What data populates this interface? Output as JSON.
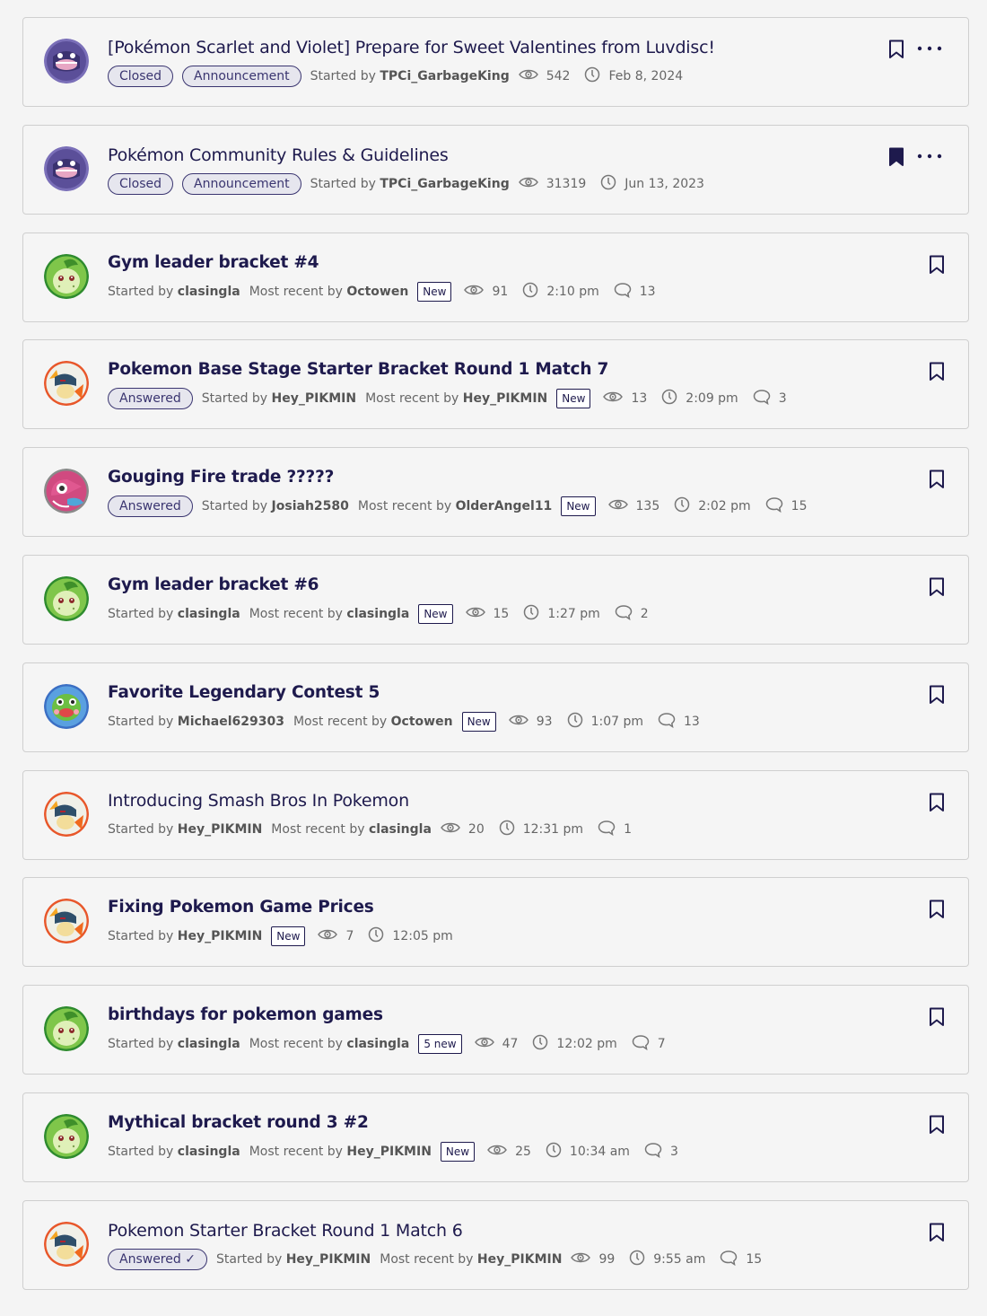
{
  "labels": {
    "started_by": "Started by",
    "most_recent_by": "Most recent by"
  },
  "colors": {
    "accent": "#1e1a4d",
    "pill_bg": "#e6e6ee",
    "card_border": "#cfcfcf",
    "meta_text": "#666666"
  },
  "topics": [
    {
      "avatar": "shuppet",
      "title": "[Pokémon Scarlet and Violet] Prepare for Sweet Valentines from Luvdisc!",
      "bold": false,
      "pills": [
        "Closed",
        "Announcement"
      ],
      "started_by": "TPCi_GarbageKing",
      "most_recent_by": null,
      "badge": null,
      "views": "542",
      "time": "Feb 8, 2024",
      "comments": null,
      "bookmarked": false,
      "menu": true
    },
    {
      "avatar": "shuppet",
      "title": "Pokémon Community Rules & Guidelines",
      "bold": false,
      "pills": [
        "Closed",
        "Announcement"
      ],
      "started_by": "TPCi_GarbageKing",
      "most_recent_by": null,
      "badge": null,
      "views": "31319",
      "time": "Jun 13, 2023",
      "comments": null,
      "bookmarked": true,
      "menu": true
    },
    {
      "avatar": "chikorita",
      "title": "Gym leader bracket #4",
      "bold": true,
      "pills": [],
      "started_by": "clasingla",
      "most_recent_by": "Octowen",
      "badge": "New",
      "views": "91",
      "time": "2:10 pm",
      "comments": "13",
      "bookmarked": false,
      "menu": false
    },
    {
      "avatar": "quilava",
      "title": "Pokemon Base Stage Starter Bracket Round 1 Match 7",
      "bold": true,
      "pills": [
        "Answered"
      ],
      "started_by": "Hey_PIKMIN",
      "most_recent_by": "Hey_PIKMIN",
      "badge": "New",
      "views": "13",
      "time": "2:09 pm",
      "comments": "3",
      "bookmarked": false,
      "menu": false
    },
    {
      "avatar": "porygon",
      "title": "Gouging Fire trade ?????",
      "bold": true,
      "pills": [
        "Answered"
      ],
      "started_by": "Josiah2580",
      "most_recent_by": "OlderAngel11",
      "badge": "New",
      "views": "135",
      "time": "2:02 pm",
      "comments": "15",
      "bookmarked": false,
      "menu": false
    },
    {
      "avatar": "chikorita",
      "title": "Gym leader bracket #6",
      "bold": true,
      "pills": [],
      "started_by": "clasingla",
      "most_recent_by": "clasingla",
      "badge": "New",
      "views": "15",
      "time": "1:27 pm",
      "comments": "2",
      "bookmarked": false,
      "menu": false
    },
    {
      "avatar": "politoed",
      "title": "Favorite Legendary Contest 5",
      "bold": true,
      "pills": [],
      "started_by": "Michael629303",
      "most_recent_by": "Octowen",
      "badge": "New",
      "views": "93",
      "time": "1:07 pm",
      "comments": "13",
      "bookmarked": false,
      "menu": false
    },
    {
      "avatar": "quilava",
      "title": "Introducing Smash Bros In Pokemon",
      "bold": false,
      "pills": [],
      "started_by": "Hey_PIKMIN",
      "most_recent_by": "clasingla",
      "badge": null,
      "views": "20",
      "time": "12:31 pm",
      "comments": "1",
      "bookmarked": false,
      "menu": false
    },
    {
      "avatar": "quilava",
      "title": "Fixing Pokemon Game Prices",
      "bold": true,
      "pills": [],
      "started_by": "Hey_PIKMIN",
      "most_recent_by": null,
      "badge": "New",
      "views": "7",
      "time": "12:05 pm",
      "comments": null,
      "bookmarked": false,
      "menu": false
    },
    {
      "avatar": "chikorita",
      "title": "birthdays for pokemon games",
      "bold": true,
      "pills": [],
      "started_by": "clasingla",
      "most_recent_by": "clasingla",
      "badge": "5 new",
      "views": "47",
      "time": "12:02 pm",
      "comments": "7",
      "bookmarked": false,
      "menu": false
    },
    {
      "avatar": "chikorita",
      "title": "Mythical bracket round 3 #2",
      "bold": true,
      "pills": [],
      "started_by": "clasingla",
      "most_recent_by": "Hey_PIKMIN",
      "badge": "New",
      "views": "25",
      "time": "10:34 am",
      "comments": "3",
      "bookmarked": false,
      "menu": false
    },
    {
      "avatar": "quilava",
      "title": "Pokemon Starter Bracket Round 1 Match 6",
      "bold": false,
      "pills": [
        "Answered ✓"
      ],
      "started_by": "Hey_PIKMIN",
      "most_recent_by": "Hey_PIKMIN",
      "badge": null,
      "views": "99",
      "time": "9:55 am",
      "comments": "15",
      "bookmarked": false,
      "menu": false
    }
  ]
}
